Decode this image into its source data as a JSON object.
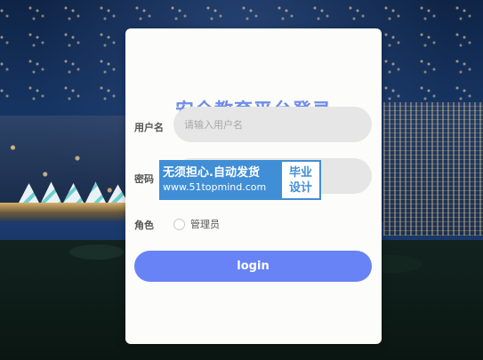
{
  "login": {
    "title": "安全教育平台登录",
    "username_label": "用户名",
    "username_placeholder": "请输入用户名",
    "password_label": "密码",
    "password_value": "",
    "role_label": "角色",
    "role_options": [
      "管理员"
    ],
    "role_selected": "",
    "submit_label": "login"
  },
  "watermark": {
    "line1": "无须担心.自动发货",
    "line2": "www.51topmind.com",
    "right_line1": "毕业",
    "right_line2": "设计"
  },
  "colors": {
    "title": "#6d8de8",
    "button": "#6783f5",
    "input_bg": "#e6e6e6",
    "watermark_blue": "#3f8ed6"
  }
}
